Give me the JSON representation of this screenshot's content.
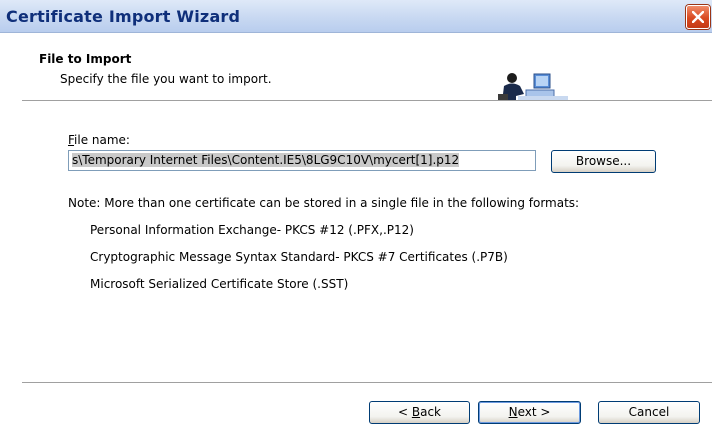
{
  "window": {
    "title": "Certificate Import Wizard"
  },
  "header": {
    "title": "File to Import",
    "subtitle": "Specify the file you want to import.",
    "icon": "user-at-computer-icon"
  },
  "form": {
    "file_label_accel": "F",
    "file_label_rest": "ile name:",
    "file_value": "s\\Temporary Internet Files\\Content.IE5\\8LG9C10V\\mycert[1].p12",
    "browse_label": "Browse..."
  },
  "info": {
    "note": "Note:  More than one certificate can be stored in a single file in the following formats:",
    "formats": [
      "Personal Information Exchange- PKCS #12 (.PFX,.P12)",
      "Cryptographic Message Syntax Standard- PKCS #7 Certificates (.P7B)",
      "Microsoft Serialized Certificate Store (.SST)"
    ]
  },
  "buttons": {
    "back_pre": "< ",
    "back_accel": "B",
    "back_rest": "ack",
    "next_accel": "N",
    "next_rest": "ext >",
    "cancel": "Cancel"
  },
  "colors": {
    "title_text": "#0f2f7a",
    "close_bg": "#d94a21",
    "button_border": "#003c74"
  }
}
